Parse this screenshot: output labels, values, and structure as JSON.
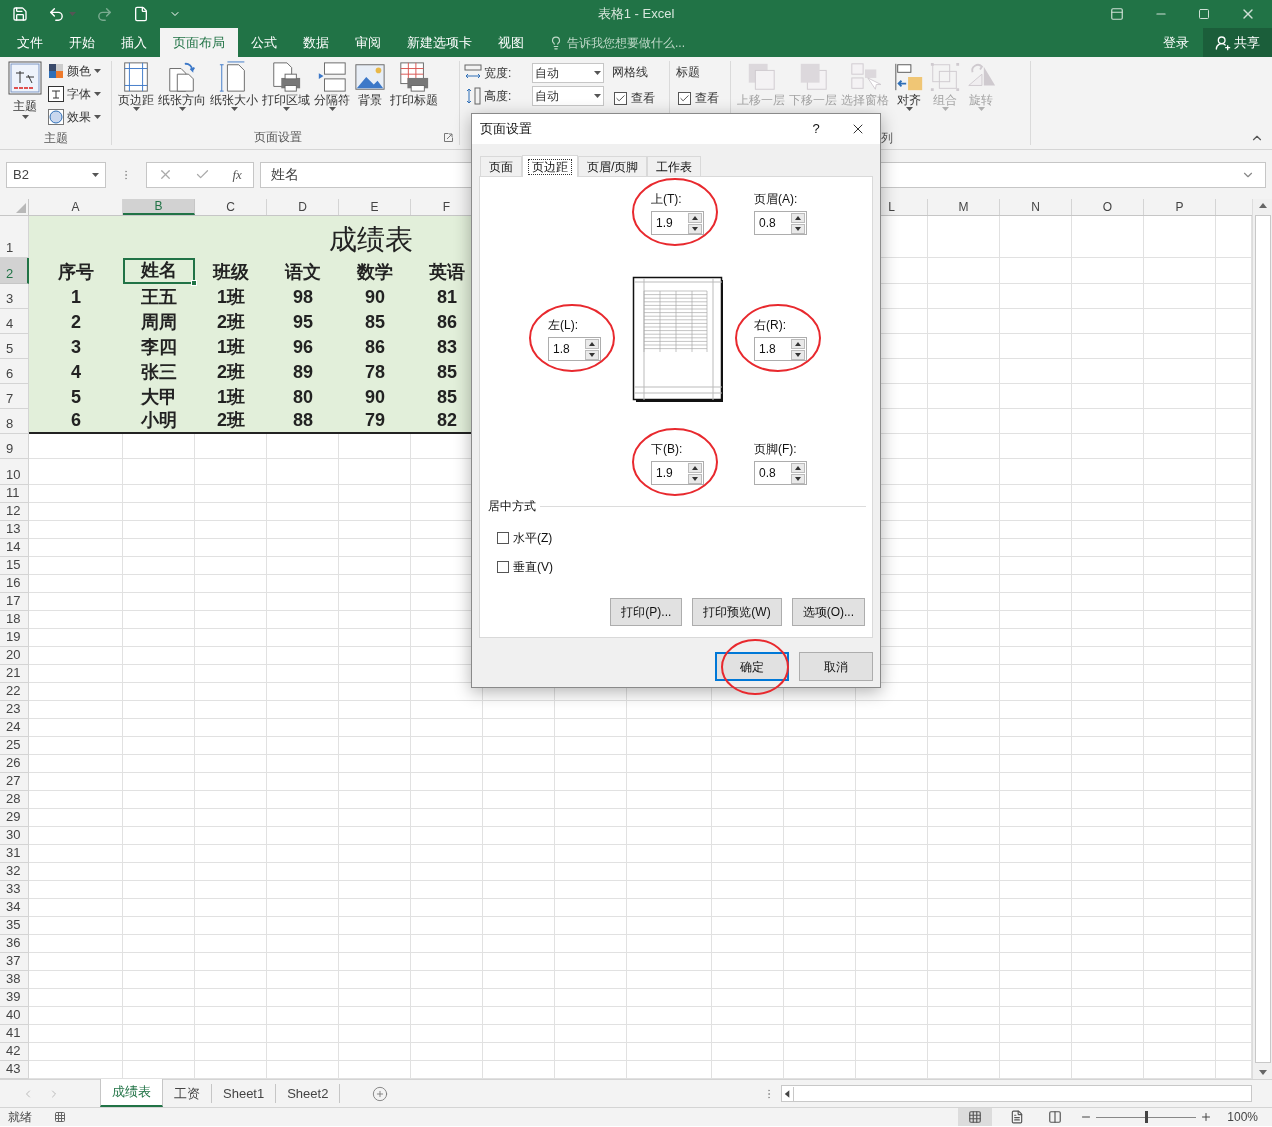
{
  "window": {
    "title": "表格1 - Excel"
  },
  "menu_tabs": [
    {
      "label": "文件",
      "selected": false
    },
    {
      "label": "开始",
      "selected": false
    },
    {
      "label": "插入",
      "selected": false
    },
    {
      "label": "页面布局",
      "selected": true
    },
    {
      "label": "公式",
      "selected": false
    },
    {
      "label": "数据",
      "selected": false
    },
    {
      "label": "审阅",
      "selected": false
    },
    {
      "label": "新建选项卡",
      "selected": false
    },
    {
      "label": "视图",
      "selected": false
    }
  ],
  "tell_me": {
    "placeholder": "告诉我您想要做什么..."
  },
  "account": {
    "login": "登录",
    "share": "共享"
  },
  "ribbon": {
    "theme_group": {
      "label": "主题",
      "main": "主题",
      "items": [
        "颜色",
        "字体",
        "效果"
      ]
    },
    "page_setup_group": {
      "label": "页面设置",
      "buttons": [
        {
          "label": "页边距",
          "dropdown": true
        },
        {
          "label": "纸张方向",
          "dropdown": true
        },
        {
          "label": "纸张大小",
          "dropdown": true
        },
        {
          "label": "打印区域",
          "dropdown": true
        },
        {
          "label": "分隔符",
          "dropdown": true
        },
        {
          "label": "背景",
          "dropdown": false
        },
        {
          "label": "打印标题",
          "dropdown": false
        }
      ]
    },
    "scale_group": {
      "fields": [
        {
          "label": "宽度:",
          "value": "自动"
        },
        {
          "label": "高度:",
          "value": "自动"
        }
      ]
    },
    "sheet_options": [
      {
        "title": "网格线",
        "option": {
          "label": "查看",
          "checked": true
        }
      },
      {
        "title": "标题",
        "option": {
          "label": "查看",
          "checked": true
        }
      }
    ],
    "arrange_group": {
      "label": "列",
      "buttons": [
        {
          "label": "上移一层",
          "disabled": true,
          "dropdown": false
        },
        {
          "label": "下移一层",
          "disabled": true,
          "dropdown": false
        },
        {
          "label": "选择窗格",
          "disabled": true,
          "dropdown": false
        },
        {
          "label": "对齐",
          "disabled": false,
          "dropdown": true
        },
        {
          "label": "组合",
          "disabled": true,
          "dropdown": true
        },
        {
          "label": "旋转",
          "disabled": true,
          "dropdown": true
        }
      ]
    }
  },
  "formula_bar": {
    "name_box": "B2",
    "function_label": "fx",
    "value": "姓名"
  },
  "column_headers_left": [
    {
      "label": "A",
      "selected": false
    },
    {
      "label": "B",
      "selected": true
    },
    {
      "label": "C",
      "selected": false
    },
    {
      "label": "D",
      "selected": false
    },
    {
      "label": "E",
      "selected": false
    },
    {
      "label": "F",
      "selected": false
    }
  ],
  "column_headers_right": [
    {
      "label": "L",
      "selected": false
    },
    {
      "label": "M",
      "selected": false
    },
    {
      "label": "N",
      "selected": false
    },
    {
      "label": "O",
      "selected": false
    },
    {
      "label": "P",
      "selected": false
    }
  ],
  "row_headers": [
    {
      "label": "1",
      "selected": false
    },
    {
      "label": "2",
      "selected": true
    },
    {
      "label": "3",
      "selected": false
    },
    {
      "label": "4",
      "selected": false
    },
    {
      "label": "5",
      "selected": false
    },
    {
      "label": "6",
      "selected": false
    },
    {
      "label": "7",
      "selected": false
    },
    {
      "label": "8",
      "selected": false
    },
    {
      "label": "9",
      "selected": false
    },
    {
      "label": "10",
      "selected": false
    },
    {
      "label": "11",
      "selected": false
    },
    {
      "label": "12",
      "selected": false
    },
    {
      "label": "13",
      "selected": false
    },
    {
      "label": "14",
      "selected": false
    },
    {
      "label": "15",
      "selected": false
    },
    {
      "label": "16",
      "selected": false
    },
    {
      "label": "17",
      "selected": false
    },
    {
      "label": "18",
      "selected": false
    },
    {
      "label": "19",
      "selected": false
    },
    {
      "label": "20",
      "selected": false
    },
    {
      "label": "21",
      "selected": false
    },
    {
      "label": "22",
      "selected": false
    },
    {
      "label": "23",
      "selected": false
    },
    {
      "label": "24",
      "selected": false
    },
    {
      "label": "25",
      "selected": false
    },
    {
      "label": "26",
      "selected": false
    },
    {
      "label": "27",
      "selected": false
    },
    {
      "label": "28",
      "selected": false
    },
    {
      "label": "29",
      "selected": false
    },
    {
      "label": "30",
      "selected": false
    },
    {
      "label": "31",
      "selected": false
    },
    {
      "label": "32",
      "selected": false
    },
    {
      "label": "33",
      "selected": false
    },
    {
      "label": "34",
      "selected": false
    },
    {
      "label": "35",
      "selected": false
    },
    {
      "label": "36",
      "selected": false
    },
    {
      "label": "37",
      "selected": false
    },
    {
      "label": "38",
      "selected": false
    },
    {
      "label": "39",
      "selected": false
    },
    {
      "label": "40",
      "selected": false
    },
    {
      "label": "41",
      "selected": false
    },
    {
      "label": "42",
      "selected": false
    },
    {
      "label": "43",
      "selected": false
    }
  ],
  "sheet": {
    "title": "成绩表",
    "header": [
      {
        "text": "序号",
        "selected": false
      },
      {
        "text": "姓名",
        "selected": true
      },
      {
        "text": "班级",
        "selected": false
      },
      {
        "text": "语文",
        "selected": false
      },
      {
        "text": "数学",
        "selected": false
      },
      {
        "text": "英语",
        "selected": false
      }
    ],
    "rows": [
      [
        "1",
        "王五",
        "1班",
        "98",
        "90",
        "81"
      ],
      [
        "2",
        "周周",
        "2班",
        "95",
        "85",
        "86"
      ],
      [
        "3",
        "李四",
        "1班",
        "96",
        "86",
        "83"
      ],
      [
        "4",
        "张三",
        "2班",
        "89",
        "78",
        "85"
      ],
      [
        "5",
        "大甲",
        "1班",
        "80",
        "90",
        "85"
      ],
      [
        "6",
        "小明",
        "2班",
        "88",
        "79",
        "82"
      ]
    ]
  },
  "sheet_tabs": [
    {
      "label": "成绩表",
      "selected": true
    },
    {
      "label": "工资",
      "selected": false
    },
    {
      "label": "Sheet1",
      "selected": false
    },
    {
      "label": "Sheet2",
      "selected": false
    }
  ],
  "status_bar": {
    "state": "就绪",
    "zoom": "100%",
    "zoom_slider": {
      "level": 0.5
    }
  },
  "dialog": {
    "title": "页面设置",
    "help": "?",
    "tabs": [
      {
        "label": "页面",
        "selected": false
      },
      {
        "label": "页边距",
        "selected": true
      },
      {
        "label": "页眉/页脚",
        "selected": false
      },
      {
        "label": "工作表",
        "selected": false
      }
    ],
    "fields": {
      "top": {
        "label": "上(T):",
        "value": "1.9",
        "circled": true
      },
      "header": {
        "label": "页眉(A):",
        "value": "0.8",
        "circled": false
      },
      "left": {
        "label": "左(L):",
        "value": "1.8",
        "circled": true
      },
      "right": {
        "label": "右(R):",
        "value": "1.8",
        "circled": true
      },
      "bottom": {
        "label": "下(B):",
        "value": "1.9",
        "circled": true
      },
      "footer": {
        "label": "页脚(F):",
        "value": "0.8",
        "circled": false
      }
    },
    "center_on_page": {
      "title": "居中方式",
      "options": [
        {
          "label": "水平(Z)",
          "checked": false
        },
        {
          "label": "垂直(V)",
          "checked": false
        }
      ]
    },
    "panel_buttons": [
      "打印(P)...",
      "打印预览(W)",
      "选项(O)..."
    ],
    "footer_buttons": [
      {
        "label": "确定",
        "default": true,
        "circled": true
      },
      {
        "label": "取消",
        "default": false,
        "circled": false
      }
    ]
  }
}
